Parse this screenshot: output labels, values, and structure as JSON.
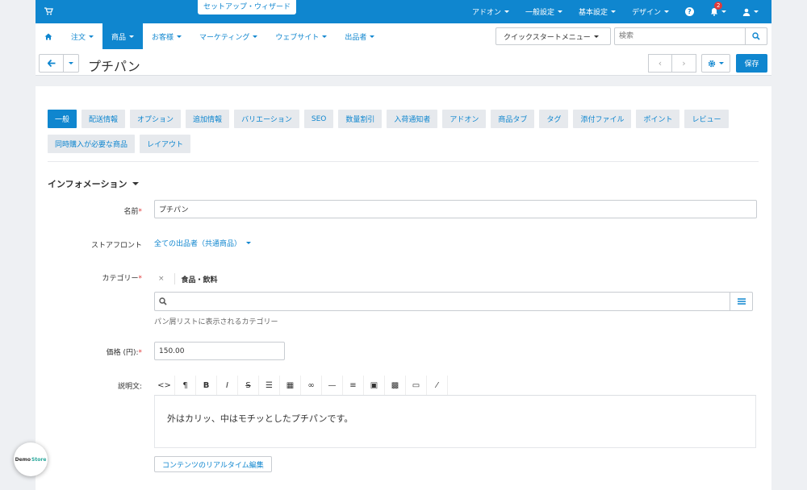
{
  "header": {
    "wizard_label": "セットアップ・ウィザード",
    "nav": [
      "アドオン",
      "一般設定",
      "基本設定",
      "デザイン"
    ],
    "notification_count": "2"
  },
  "mainnav": {
    "items": [
      "注文",
      "商品",
      "お客様",
      "マーケティング",
      "ウェブサイト",
      "出品者"
    ],
    "active_index": 1
  },
  "toolbar": {
    "quickstart_label": "クイックスタートメニュー",
    "search_placeholder": "検索",
    "page_title": "プチパン",
    "save_label": "保存"
  },
  "tabs": [
    "一般",
    "配送情報",
    "オプション",
    "追加情報",
    "バリエーション",
    "SEO",
    "数量割引",
    "入荷通知者",
    "アドオン",
    "商品タブ",
    "タグ",
    "添付ファイル",
    "ポイント",
    "レビュー",
    "同時購入が必要な商品",
    "レイアウト"
  ],
  "form": {
    "section_title": "インフォメーション",
    "name_label": "名前",
    "name_value": "プチパン",
    "storefront_label": "ストアフロント",
    "storefront_value": "全ての出品者（共通商品）",
    "category_label": "カテゴリー",
    "category_remove": "×",
    "category_value": "食品・飲料",
    "category_hint": "パン屑リストに表示されるカテゴリー",
    "price_label": "価格 (円):",
    "price_value": "150.00",
    "description_label": "説明文:",
    "description_text": "外はカリッ、中はモチッとしたプチパンです。",
    "realtime_edit_label": "コンテンツのリアルタイム編集",
    "required_mark": "*"
  },
  "demo": {
    "part1": "Demo",
    "part2": "Store"
  },
  "colors": {
    "accent": "#0f86cf",
    "required": "#e03a3a",
    "badge": "#e03a3a"
  }
}
